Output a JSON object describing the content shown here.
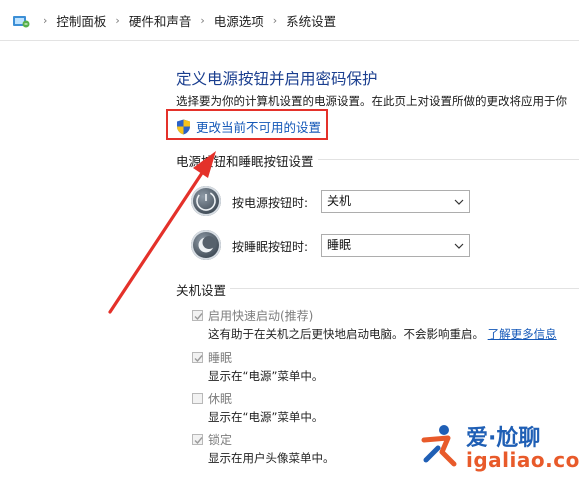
{
  "breadcrumb": {
    "items": [
      "控制面板",
      "硬件和声音",
      "电源选项",
      "系统设置"
    ]
  },
  "page": {
    "title": "定义电源按钮并启用密码保护",
    "description": "选择要为你的计算机设置的电源设置。在此页上对设置所做的更改将应用于你",
    "change_link": "更改当前不可用的设置"
  },
  "power_buttons": {
    "section_title": "电源按钮和睡眠按钮设置",
    "power_label": "按电源按钮时:",
    "power_value": "关机",
    "sleep_label": "按睡眠按钮时:",
    "sleep_value": "睡眠"
  },
  "shutdown": {
    "section_title": "关机设置",
    "items": [
      {
        "label": "启用快速启动(推荐)",
        "desc": "这有助于在关机之后更快地启动电脑。不会影响重启。",
        "checked": true
      },
      {
        "label": "睡眠",
        "desc": "显示在“电源”菜单中。",
        "checked": true
      },
      {
        "label": "休眠",
        "desc": "显示在“电源”菜单中。",
        "checked": false
      },
      {
        "label": "锁定",
        "desc": "显示在用户头像菜单中。",
        "checked": true
      }
    ],
    "learn_more": "了解更多信息"
  },
  "watermark": {
    "title": "爱·尬聊",
    "url": "igaliao.com"
  },
  "colors": {
    "highlight_box": "#e4312a",
    "link": "#1458b8",
    "title": "#1a3e8f"
  },
  "icons": {
    "breadcrumb": "control-panel-icon",
    "shield": "uac-shield-icon",
    "power_button": "power-button-icon",
    "sleep_button": "sleep-button-icon"
  }
}
